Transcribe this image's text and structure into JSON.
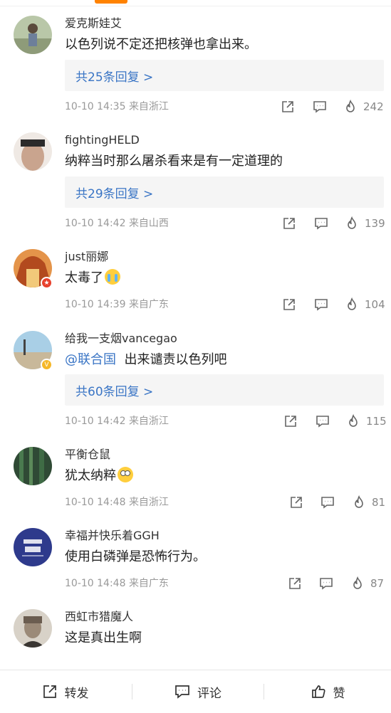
{
  "comments": [
    {
      "user": "爱克斯娃艾",
      "text": "以色列说不定还把核弹也拿出来。",
      "replies": "共25条回复 >",
      "time": "10-10 14:35",
      "location": "来自浙江",
      "likes": "242"
    },
    {
      "user": "fightingHELD",
      "text": "纳粹当时那么屠杀看来是有一定道理的",
      "replies": "共29条回复 >",
      "time": "10-10 14:42",
      "location": "来自山西",
      "likes": "139"
    },
    {
      "user": "just丽娜",
      "text": "太毒了",
      "time": "10-10 14:39",
      "location": "来自广东",
      "likes": "104"
    },
    {
      "user": "给我一支烟vancegao",
      "mention": "@联合国",
      "text": "出来谴责以色列吧",
      "replies": "共60条回复 >",
      "time": "10-10 14:42",
      "location": "来自浙江",
      "likes": "115"
    },
    {
      "user": "平衡仓鼠",
      "text": "犹太纳粹",
      "time": "10-10 14:48",
      "location": "来自浙江",
      "likes": "81"
    },
    {
      "user": "幸福并快乐着GGH",
      "text": "使用白磷弹是恐怖行为。",
      "time": "10-10 14:48",
      "location": "来自广东",
      "likes": "87"
    },
    {
      "user": "西虹市猎魔人",
      "text": "这是真出生啊"
    }
  ],
  "bottom_bar": {
    "repost": "转发",
    "comment": "评论",
    "like": "赞"
  },
  "colors": {
    "accent": "#ff8200",
    "link": "#3a75c5",
    "meta": "#999999"
  }
}
